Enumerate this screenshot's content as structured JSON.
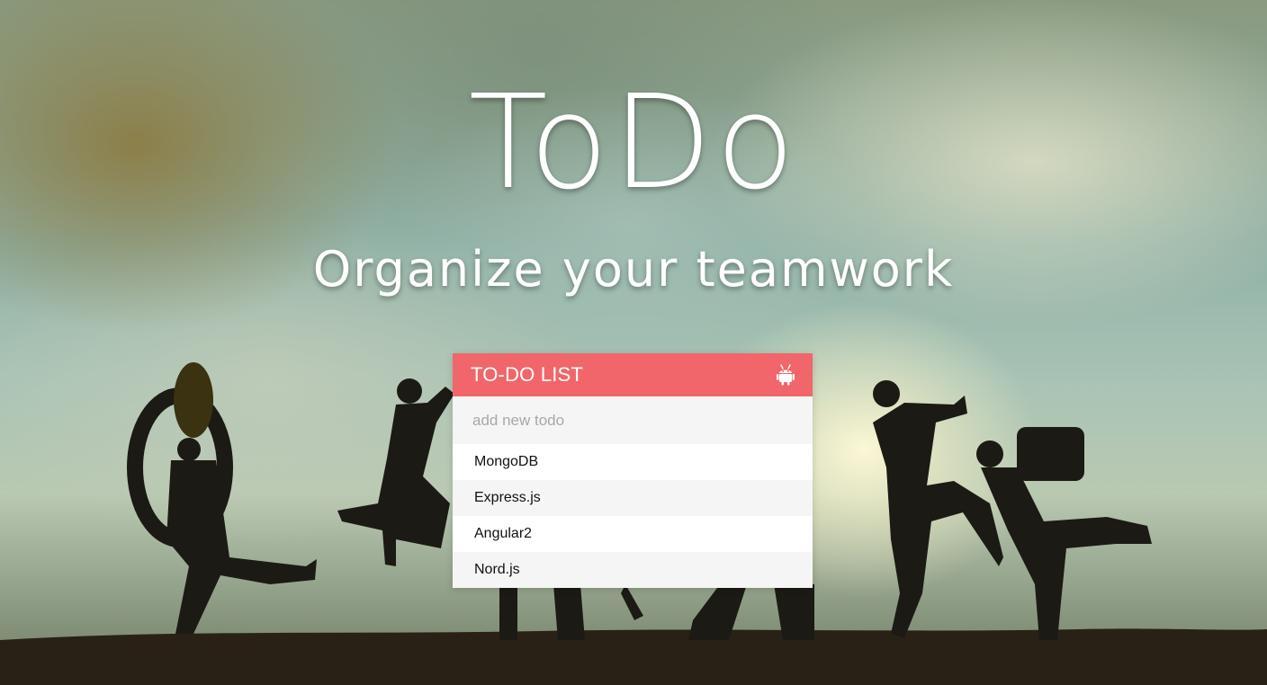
{
  "hero": {
    "title": "ToDo",
    "subtitle": "Organize your teamwork"
  },
  "card": {
    "title": "TO-DO LIST",
    "header_icon": "android-icon",
    "header_color": "#f0666a",
    "input": {
      "placeholder": "add new todo",
      "value": ""
    },
    "items": [
      {
        "label": "MongoDB"
      },
      {
        "label": "Express.js"
      },
      {
        "label": "Angular2"
      },
      {
        "label": "Nord.js"
      }
    ]
  }
}
